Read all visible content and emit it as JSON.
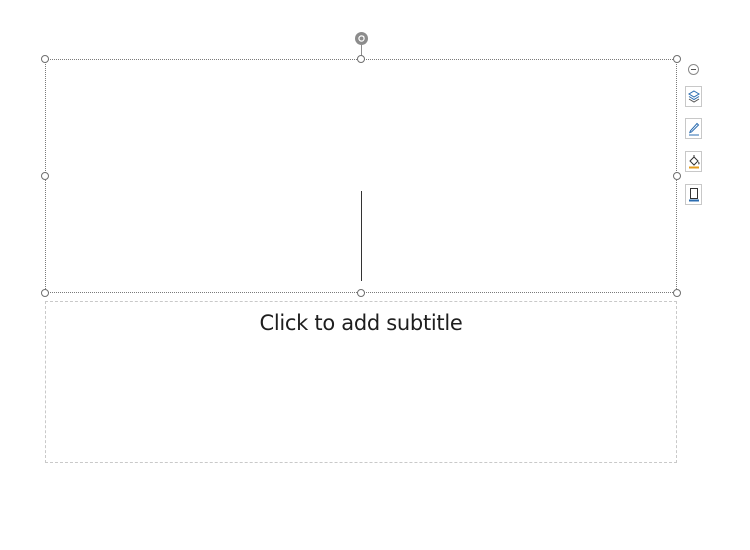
{
  "slide": {
    "subtitle_placeholder": "Click to add subtitle"
  },
  "floating_toolbar": {
    "buttons": [
      {
        "icon": "collapse-icon"
      },
      {
        "icon": "layers-icon"
      },
      {
        "icon": "pen-icon"
      },
      {
        "icon": "fill-bucket-icon"
      },
      {
        "icon": "shape-outline-icon"
      }
    ]
  },
  "colors": {
    "selection_border": "#7a7a7a",
    "placeholder_border": "#c9c9c9",
    "rotate_handle": "#8c8c8c",
    "accent_blue": "#2b6cb0",
    "accent_orange": "#e39b1c"
  }
}
